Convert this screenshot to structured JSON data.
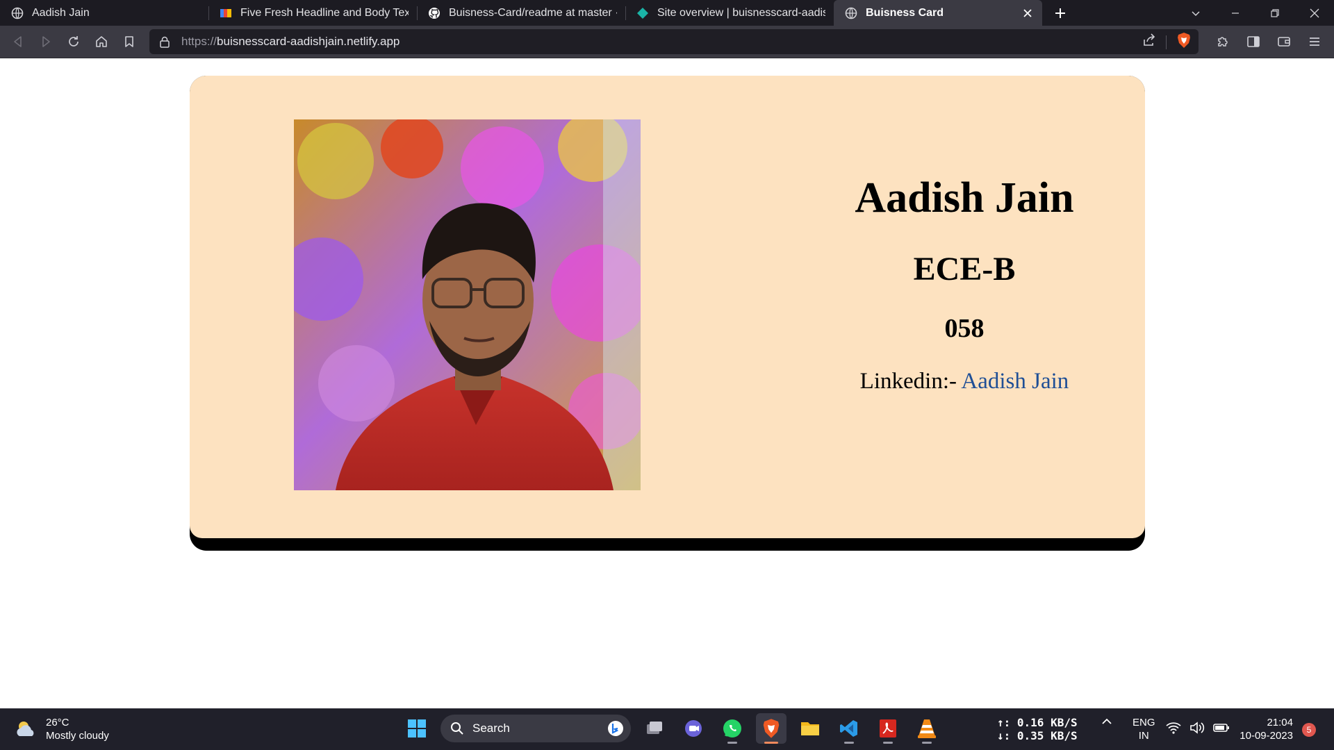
{
  "browser": {
    "tabs": [
      {
        "title": "Aadish Jain",
        "icon": "globe-icon",
        "active": false
      },
      {
        "title": "Five Fresh Headline and Body Text Pairings",
        "icon": "canva-icon",
        "active": false
      },
      {
        "title": "Buisness-Card/readme at master · Aadish",
        "icon": "github-icon",
        "active": false
      },
      {
        "title": "Site overview | buisnesscard-aadishjain",
        "icon": "netlify-icon",
        "active": false
      },
      {
        "title": "Buisness Card",
        "icon": "globe-icon",
        "active": true
      }
    ],
    "url_protocol": "https://",
    "url_host": "buisnesscard-aadishjain.netlify.app"
  },
  "card": {
    "name": "Aadish Jain",
    "department": "ECE-B",
    "roll": "058",
    "linkedin_label": "Linkedin:- ",
    "linkedin_link": "Aadish Jain",
    "photo_icon": "profile-photo",
    "colors": {
      "background": "#fde2c0",
      "link": "#1f4f96",
      "shadow": "#000000"
    }
  },
  "taskbar": {
    "weather_temp": "26°C",
    "weather_desc": "Mostly cloudy",
    "search_placeholder": "Search",
    "net_up": "↑: 0.16 KB/S",
    "net_down": "↓: 0.35 KB/S",
    "lang_line1": "ENG",
    "lang_line2": "IN",
    "time": "21:04",
    "date": "10-09-2023",
    "notification_count": "5"
  }
}
